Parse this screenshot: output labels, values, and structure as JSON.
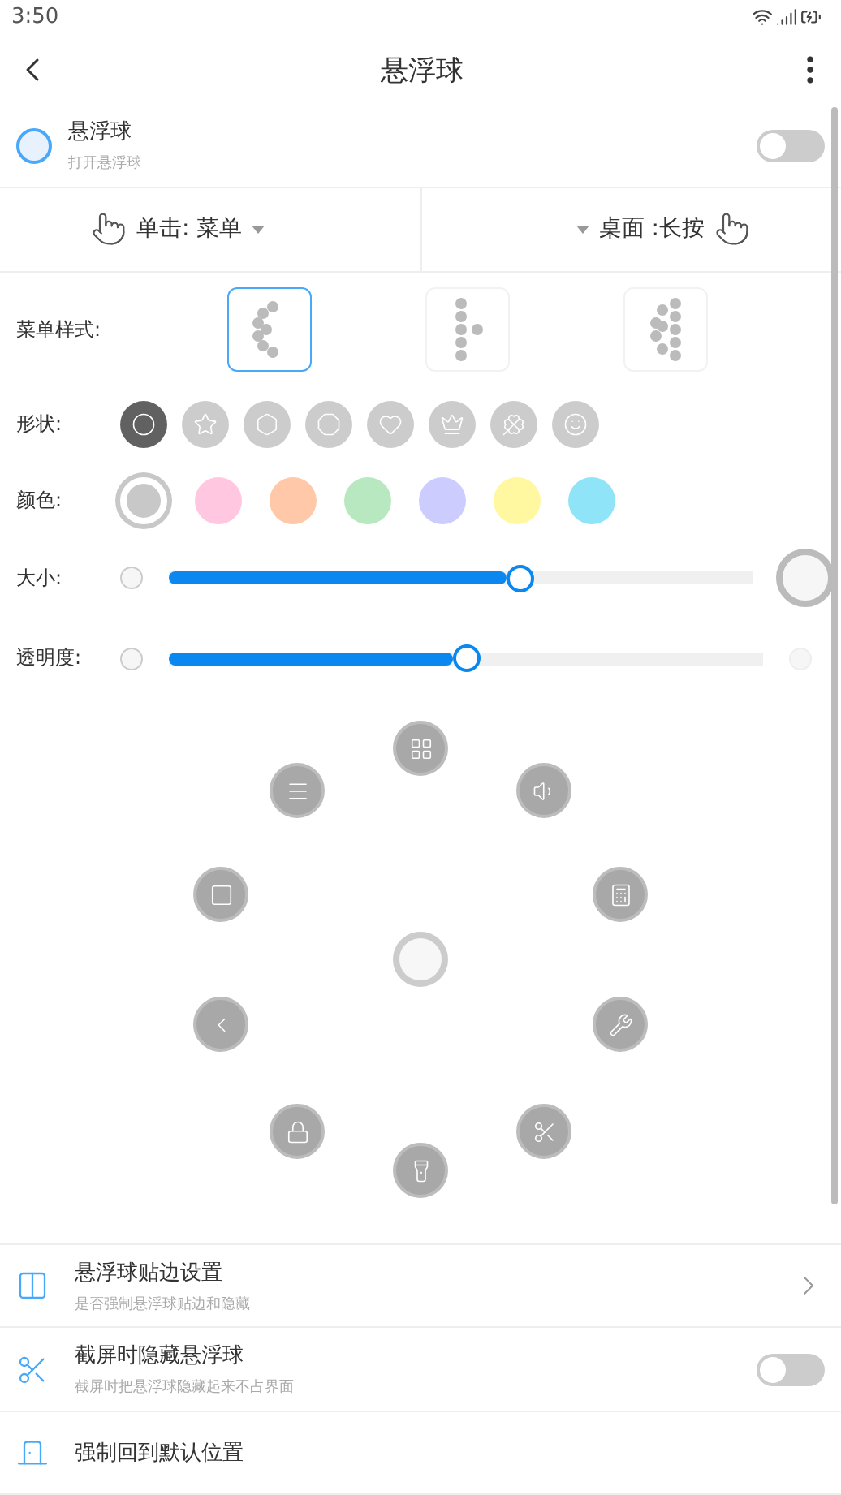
{
  "status_bar": {
    "time": "3:50"
  },
  "toolbar": {
    "title": "悬浮球"
  },
  "master": {
    "title": "悬浮球",
    "subtitle": "打开悬浮球",
    "on": false
  },
  "gestures": [
    {
      "label": "单击: 菜单"
    },
    {
      "label": "桌面 :长按"
    }
  ],
  "menu_style": {
    "label": "菜单样式:",
    "options": [
      {
        "kind": "arc",
        "selected": true
      },
      {
        "kind": "column",
        "selected": false
      },
      {
        "kind": "double",
        "selected": false
      }
    ]
  },
  "shape": {
    "label": "形状:",
    "options": [
      {
        "kind": "circle",
        "selected": true
      },
      {
        "kind": "star",
        "selected": false
      },
      {
        "kind": "hexagon",
        "selected": false
      },
      {
        "kind": "octagon",
        "selected": false
      },
      {
        "kind": "heart",
        "selected": false
      },
      {
        "kind": "crown",
        "selected": false
      },
      {
        "kind": "clover",
        "selected": false
      },
      {
        "kind": "smile",
        "selected": false
      }
    ]
  },
  "color": {
    "label": "颜色:",
    "options": [
      {
        "color": "#c8c8c8",
        "selected": true
      },
      {
        "color": "#ffc8e0",
        "selected": false
      },
      {
        "color": "#ffc8a8",
        "selected": false
      },
      {
        "color": "#b8e8c0",
        "selected": false
      },
      {
        "color": "#ccccff",
        "selected": false
      },
      {
        "color": "#fff8a0",
        "selected": false
      },
      {
        "color": "#90e4f8",
        "selected": false
      }
    ]
  },
  "sliders": [
    {
      "label": "大小:",
      "kind": "size",
      "level": 0.6
    },
    {
      "label": "透明度:",
      "kind": "opacity",
      "level": 0.5
    }
  ],
  "radial_menu": {
    "items": [
      {
        "kind": "apps"
      },
      {
        "kind": "menu"
      },
      {
        "kind": "volume"
      },
      {
        "kind": "home"
      },
      {
        "kind": "calculator"
      },
      {
        "kind": "back"
      },
      {
        "kind": "tools"
      },
      {
        "kind": "lock"
      },
      {
        "kind": "scissors"
      },
      {
        "kind": "flashlight"
      }
    ]
  },
  "settings": [
    {
      "title": "悬浮球贴边设置",
      "subtitle": "是否强制悬浮球贴边和隐藏",
      "kind": "link"
    },
    {
      "title": "截屏时隐藏悬浮球",
      "subtitle": "截屏时把悬浮球隐藏起来不占界面",
      "kind": "toggle",
      "on": false
    },
    {
      "title": "强制回到默认位置",
      "kind": "plain"
    }
  ]
}
